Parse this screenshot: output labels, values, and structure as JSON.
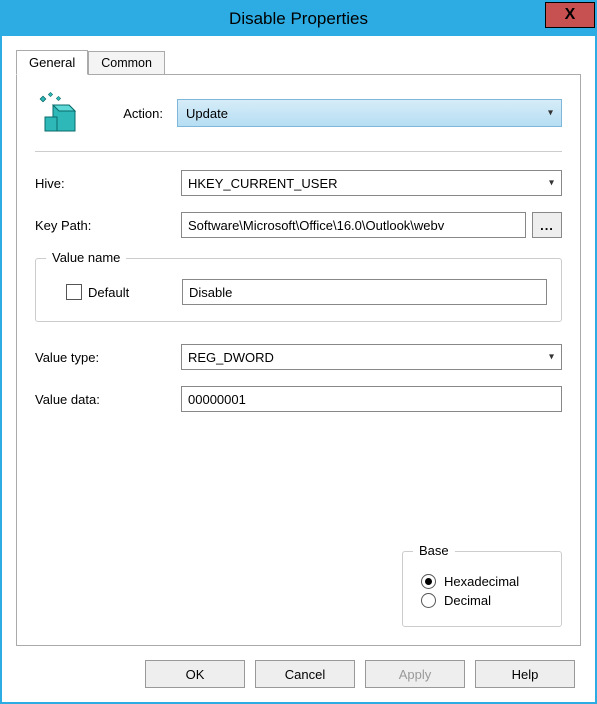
{
  "window": {
    "title": "Disable Properties",
    "close_glyph": "X"
  },
  "tabs": {
    "general": "General",
    "common": "Common"
  },
  "general": {
    "action_label": "Action:",
    "action_value": "Update",
    "hive_label": "Hive:",
    "hive_value": "HKEY_CURRENT_USER",
    "keypath_label": "Key Path:",
    "keypath_value": "Software\\Microsoft\\Office\\16.0\\Outlook\\webv",
    "browse_glyph": "...",
    "valuename_legend": "Value name",
    "default_label": "Default",
    "valuename_value": "Disable",
    "valuetype_label": "Value type:",
    "valuetype_value": "REG_DWORD",
    "valuedata_label": "Value data:",
    "valuedata_value": "00000001",
    "base_legend": "Base",
    "base_hex": "Hexadecimal",
    "base_dec": "Decimal"
  },
  "buttons": {
    "ok": "OK",
    "cancel": "Cancel",
    "apply": "Apply",
    "help": "Help"
  }
}
